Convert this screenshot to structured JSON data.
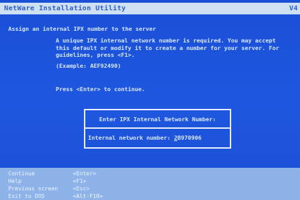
{
  "title_bar": {
    "title": "NetWare Installation Utility",
    "version": "V4"
  },
  "main": {
    "heading": "Assign an internal IPX number to the server",
    "paragraph_lines": [
      "A unique IPX internal network number is required. You may accept",
      "this default or modify it to create a number for your server. For",
      "guidelines, press <F1>."
    ],
    "example": "(Example: AEF92490)",
    "press": "Press <Enter> to continue."
  },
  "dialog": {
    "title": "Enter IPX Internal Network Number:",
    "field_label": "Internal network number: ",
    "field_value_first": "2",
    "field_value_rest": "B970906"
  },
  "key_help": [
    {
      "label": "Continue",
      "key": "<Enter>"
    },
    {
      "label": "Help",
      "key": "<F1>"
    },
    {
      "label": "Previous screen",
      "key": "<Esc>"
    },
    {
      "label": "Exit to DOS",
      "key": "<Alt-F10>"
    }
  ],
  "colors": {
    "screen_bg": "#1f57e0",
    "title_bar_bg": "#cfe0f3",
    "text": "#d7e8ff",
    "help_bar_bg": "#8db3e8"
  }
}
